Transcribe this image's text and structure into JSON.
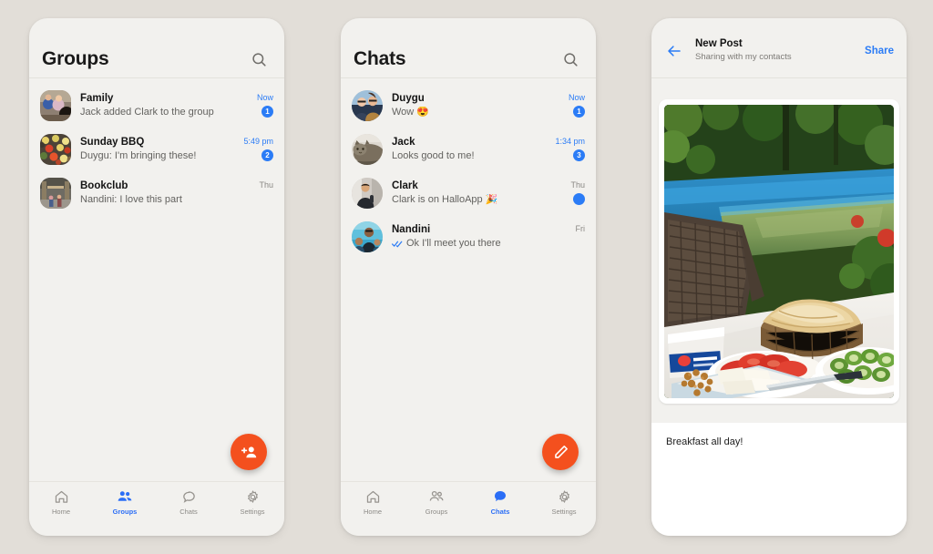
{
  "theme": {
    "page_bg": "#e2ded8",
    "panel_bg": "#f2f1ee",
    "accent_blue": "#2b7cf6",
    "accent_orange": "#f4501e",
    "text_primary": "#141414",
    "text_secondary": "#63625f",
    "text_muted": "#8a8884"
  },
  "groups_screen": {
    "title": "Groups",
    "search_icon": "search-icon",
    "fab": {
      "icon": "add-group-icon",
      "color": "#f4501e"
    },
    "rows": [
      {
        "name": "Family",
        "preview": "Jack added Clark to the group",
        "time": "Now",
        "time_style": "recent",
        "badge": "1",
        "avatar": "group-family-photo"
      },
      {
        "name": "Sunday BBQ",
        "preview": "Duygu: I'm bringing these!",
        "time": "5:49 pm",
        "time_style": "recent",
        "badge": "2",
        "avatar": "group-bbq-photo"
      },
      {
        "name": "Bookclub",
        "preview": "Nandini: I love this part",
        "time": "Thu",
        "time_style": "old",
        "badge": "",
        "avatar": "group-bookclub-photo"
      }
    ],
    "tabs": [
      {
        "label": "Home",
        "icon": "home-icon",
        "active": false
      },
      {
        "label": "Groups",
        "icon": "groups-icon",
        "active": true
      },
      {
        "label": "Chats",
        "icon": "chats-icon",
        "active": false
      },
      {
        "label": "Settings",
        "icon": "settings-gear-icon",
        "active": false
      }
    ]
  },
  "chats_screen": {
    "title": "Chats",
    "search_icon": "search-icon",
    "fab": {
      "icon": "compose-pencil-icon",
      "color": "#f4501e"
    },
    "rows": [
      {
        "name": "Duygu",
        "preview": "Wow 😍",
        "time": "Now",
        "time_style": "recent",
        "badge": "1",
        "read_receipt": false,
        "avatar": "chat-duygu-photo"
      },
      {
        "name": "Jack",
        "preview": "Looks good to me!",
        "time": "1:34 pm",
        "time_style": "recent",
        "badge": "3",
        "read_receipt": false,
        "avatar": "chat-jack-photo"
      },
      {
        "name": "Clark",
        "preview": "Clark is on HalloApp 🎉",
        "time": "Thu",
        "time_style": "old",
        "badge": "•",
        "read_receipt": false,
        "avatar": "chat-clark-photo"
      },
      {
        "name": "Nandini",
        "preview": "Ok I'll meet you there",
        "time": "Fri",
        "time_style": "old",
        "badge": "",
        "read_receipt": true,
        "avatar": "chat-nandini-photo"
      }
    ],
    "tabs": [
      {
        "label": "Home",
        "icon": "home-icon",
        "active": false
      },
      {
        "label": "Groups",
        "icon": "groups-icon",
        "active": false
      },
      {
        "label": "Chats",
        "icon": "chats-icon",
        "active": true
      },
      {
        "label": "Settings",
        "icon": "settings-gear-icon",
        "active": false
      }
    ]
  },
  "new_post_screen": {
    "back_icon": "back-arrow-icon",
    "title": "New Post",
    "subtitle": "Sharing with my contacts",
    "share_label": "Share",
    "photo": {
      "alt": "breakfast-spread-by-pool-photo",
      "description": "Outdoor breakfast table with flatbread basket, sliced tomatoes, cucumbers, cheese and walnuts beside a blue swimming pool"
    },
    "caption": "Breakfast all day!"
  }
}
